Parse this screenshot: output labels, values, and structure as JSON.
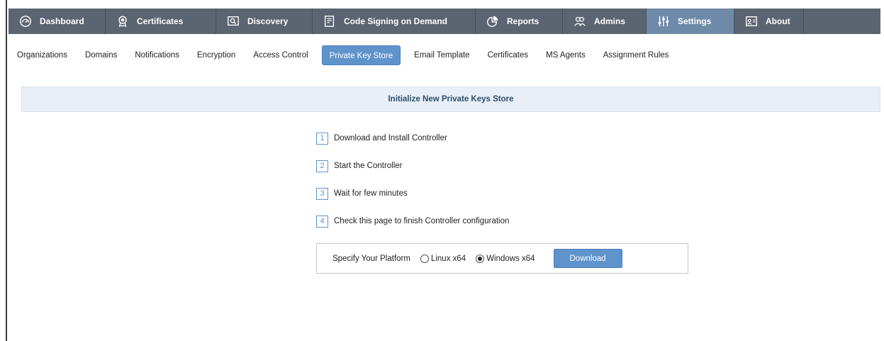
{
  "topnav": {
    "tabs": [
      {
        "label": "Dashboard",
        "icon": "dashboard-icon"
      },
      {
        "label": "Certificates",
        "icon": "certificate-icon"
      },
      {
        "label": "Discovery",
        "icon": "discovery-icon"
      },
      {
        "label": "Code Signing on Demand",
        "icon": "code-signing-icon"
      },
      {
        "label": "Reports",
        "icon": "reports-icon"
      },
      {
        "label": "Admins",
        "icon": "admins-icon"
      },
      {
        "label": "Settings",
        "icon": "settings-icon",
        "active": true
      },
      {
        "label": "About",
        "icon": "about-icon"
      }
    ]
  },
  "subnav": {
    "items": [
      {
        "label": "Organizations"
      },
      {
        "label": "Domains"
      },
      {
        "label": "Notifications"
      },
      {
        "label": "Encryption"
      },
      {
        "label": "Access Control"
      },
      {
        "label": "Private Key Store",
        "active": true
      },
      {
        "label": "Email Template"
      },
      {
        "label": "Certificates"
      },
      {
        "label": "MS Agents"
      },
      {
        "label": "Assignment Rules"
      }
    ]
  },
  "banner": {
    "title": "Initialize New Private Keys Store"
  },
  "steps": [
    {
      "num": "1",
      "text": "Download and Install Controller"
    },
    {
      "num": "2",
      "text": "Start the Controller"
    },
    {
      "num": "3",
      "text": "Wait for few minutes"
    },
    {
      "num": "4",
      "text": "Check this page to finish Controller configuration"
    }
  ],
  "platform": {
    "label": "Specify Your Platform",
    "options": [
      {
        "label": "Linux x64",
        "selected": false
      },
      {
        "label": "Windows x64",
        "selected": true
      }
    ],
    "download_label": "Download"
  },
  "colors": {
    "topnav_bg": "#5b6571",
    "active_tab": "#6f8aa8",
    "accent": "#5f93cc",
    "banner_bg": "#e8eff6"
  }
}
